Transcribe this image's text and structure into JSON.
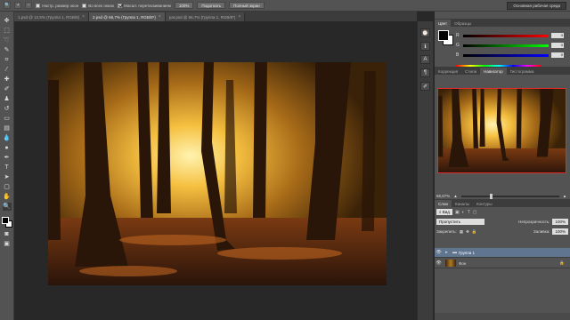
{
  "options_bar": {
    "checks": [
      {
        "label": "Настр. размер окон",
        "checked": false
      },
      {
        "label": "Во всех окнах",
        "checked": false
      },
      {
        "label": "Масшт. перетаскиванием",
        "checked": true
      }
    ],
    "buttons": [
      "100%",
      "Подогнать",
      "Полный экран"
    ],
    "workspace": "Основная рабочая среда"
  },
  "tabs": [
    {
      "label": "1.psd @ 12,5% (Группа 1, RGB/8)",
      "active": false
    },
    {
      "label": "2.psd @ 66,7% (Группа 1, RGB/8*)",
      "active": true
    },
    {
      "label": "pat.psd @ 66,7% (Группа 1, RGB/8*)",
      "active": false
    }
  ],
  "color_panel": {
    "tabs": [
      "Цвет",
      "Образцы"
    ],
    "channels": [
      {
        "label": "R",
        "value": "0",
        "gradient": "linear-gradient(90deg,#000,#f00)"
      },
      {
        "label": "G",
        "value": "0",
        "gradient": "linear-gradient(90deg,#000,#0f0)"
      },
      {
        "label": "B",
        "value": "0",
        "gradient": "linear-gradient(90deg,#000,#00f)"
      }
    ]
  },
  "navigator_panel": {
    "tabs": [
      "Коррекция",
      "Стили",
      "Навигатор",
      "Гистограмма"
    ],
    "active_tab": "Навигатор",
    "zoom": "66,67%"
  },
  "layers_panel": {
    "tabs": [
      "Слои",
      "Каналы",
      "Контуры"
    ],
    "filter": "Вид",
    "blend_mode": "Пропустить",
    "opacity_label": "Непрозрачность:",
    "opacity_value": "100%",
    "lock_label": "Закрепить:",
    "fill_label": "Заливка:",
    "fill_value": "100%",
    "layers": [
      {
        "name": "Группа 1",
        "selected": true
      },
      {
        "name": "Фон",
        "selected": false
      }
    ]
  },
  "colors": {
    "accent_selected": "#5f7590",
    "navigator_frame": "#e8282a"
  }
}
